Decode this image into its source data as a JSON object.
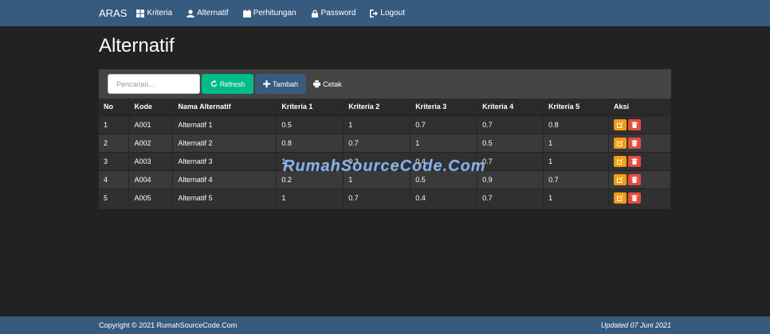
{
  "nav": {
    "brand": "ARAS",
    "items": [
      {
        "label": "Kriteria",
        "icon": "grid-icon"
      },
      {
        "label": "Alternatif",
        "icon": "user-icon"
      },
      {
        "label": "Perhitungan",
        "icon": "calendar-icon"
      },
      {
        "label": "Password",
        "icon": "lock-icon"
      },
      {
        "label": "Logout",
        "icon": "logout-icon"
      }
    ]
  },
  "page": {
    "title": "Alternatif"
  },
  "toolbar": {
    "search_placeholder": "Pencarian...",
    "refresh_label": "Refresh",
    "tambah_label": "Tambah",
    "cetak_label": "Cetak"
  },
  "table": {
    "headers": [
      "No",
      "Kode",
      "Nama Alternatif",
      "Kriteria 1",
      "Kriteria 2",
      "Kriteria 3",
      "Kriteria 4",
      "Kriteria 5",
      "Aksi"
    ],
    "rows": [
      [
        "1",
        "A001",
        "Alternatif 1",
        "0.5",
        "1",
        "0.7",
        "0.7",
        "0.8"
      ],
      [
        "2",
        "A002",
        "Alternatif 2",
        "0.8",
        "0.7",
        "1",
        "0.5",
        "1"
      ],
      [
        "3",
        "A003",
        "Alternatif 3",
        "1",
        "0.3",
        "0.4",
        "0.7",
        "1"
      ],
      [
        "4",
        "A004",
        "Alternatif 4",
        "0.2",
        "1",
        "0.5",
        "0.9",
        "0.7"
      ],
      [
        "5",
        "A005",
        "Alternatif 5",
        "1",
        "0.7",
        "0.4",
        "0.7",
        "1"
      ]
    ]
  },
  "watermark": "RumahSourceCode.Com",
  "footer": {
    "copyright": "Copyright © 2021 RumahSourceCode.Com",
    "updated": "Updated 07 Juni 2021"
  },
  "colors": {
    "navbar": "#375a7f",
    "background": "#222222",
    "refresh": "#00bc8c",
    "edit": "#f39c12",
    "delete": "#e74c3c"
  }
}
